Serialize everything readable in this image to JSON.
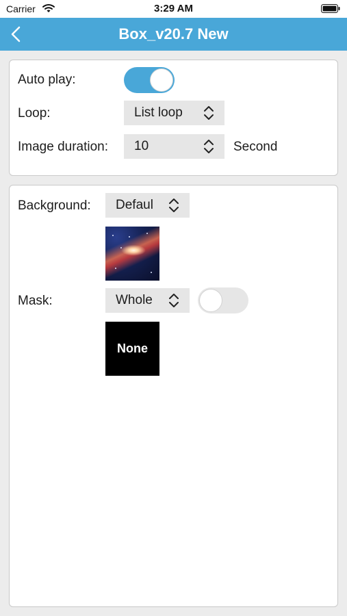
{
  "status_bar": {
    "carrier": "Carrier",
    "time": "3:29 AM"
  },
  "nav": {
    "title": "Box_v20.7 New",
    "back_icon": "chevron-left-icon"
  },
  "playback": {
    "auto_play_label": "Auto play:",
    "auto_play_on": true,
    "loop_label": "Loop:",
    "loop_value": "List loop",
    "image_duration_label": "Image duration:",
    "image_duration_value": "10",
    "image_duration_unit": "Second"
  },
  "appearance": {
    "background_label": "Background:",
    "background_value": "Defaul",
    "mask_label": "Mask:",
    "mask_value": "Whole",
    "mask_toggle_on": false,
    "mask_preview_label": "None"
  },
  "colors": {
    "accent": "#49a7d8",
    "background": "#ececec",
    "card": "#ffffff",
    "select": "#e6e6e6"
  }
}
